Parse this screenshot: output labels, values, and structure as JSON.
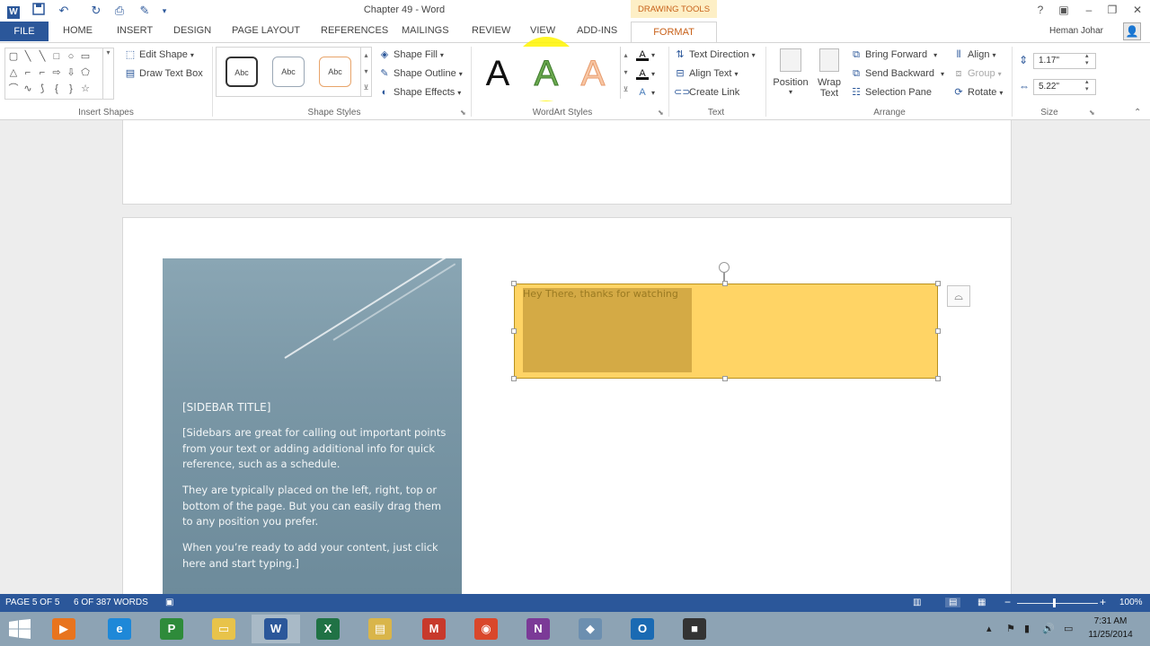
{
  "window": {
    "title": "Chapter 49 - Word",
    "contextual_header": "DRAWING TOOLS",
    "controls": [
      "?",
      "▣",
      "–",
      "❐",
      "✕"
    ]
  },
  "tabs": {
    "file": "FILE",
    "items": [
      "HOME",
      "INSERT",
      "DESIGN",
      "PAGE LAYOUT",
      "REFERENCES",
      "MAILINGS",
      "REVIEW",
      "VIEW",
      "ADD-INS"
    ],
    "active": "FORMAT",
    "user": "Heman Johar"
  },
  "ribbon": {
    "insert_shapes": {
      "label": "Insert Shapes",
      "edit_shape": "Edit Shape",
      "draw_text_box": "Draw Text Box"
    },
    "shape_styles": {
      "label": "Shape Styles",
      "swatch_text": "Abc",
      "swatch_borders": [
        "#333333",
        "#9aa7b5",
        "#e8a46a"
      ],
      "shape_fill": "Shape Fill",
      "shape_outline": "Shape Outline",
      "shape_effects": "Shape Effects"
    },
    "wordart_styles": {
      "label": "WordArt Styles",
      "letter": "A",
      "letter_colors": [
        "#111111",
        "#6aa84f",
        "#f4b183"
      ]
    },
    "text": {
      "label": "Text",
      "text_direction": "Text Direction",
      "align_text": "Align Text",
      "create_link": "Create Link"
    },
    "arrange": {
      "label": "Arrange",
      "position": "Position",
      "wrap_text_1": "Wrap",
      "wrap_text_2": "Text",
      "bring_forward": "Bring Forward",
      "send_backward": "Send Backward",
      "selection_pane": "Selection Pane",
      "align": "Align",
      "group": "Group",
      "rotate": "Rotate"
    },
    "size": {
      "label": "Size",
      "height": "1.17\"",
      "width": "5.22\""
    }
  },
  "document": {
    "sidebar_title": "[SIDEBAR TITLE]",
    "sidebar_p1": "[Sidebars are great for calling out important points from your text or adding additional info for quick reference, such as a schedule.",
    "sidebar_p2": "They are typically placed on the left, right, top or bottom of the page. But you can easily drag them to any position you prefer.",
    "sidebar_p3": "When you’re ready to add your content, just click here and start typing.]",
    "textbox_text": "Hey There, thanks for watching",
    "textbox_fill": "#ffd465"
  },
  "status": {
    "page": "PAGE 5 OF 5",
    "words": "6 OF 387 WORDS",
    "zoom": "100%"
  },
  "taskbar": {
    "apps": [
      {
        "name": "media-player",
        "glyph": "▶",
        "color": "#e8741e"
      },
      {
        "name": "internet-explorer",
        "glyph": "e",
        "color": "#1e88d8"
      },
      {
        "name": "project",
        "glyph": "P",
        "color": "#2e8b3a"
      },
      {
        "name": "folder",
        "glyph": "▭",
        "color": "#e8c34a"
      },
      {
        "name": "word",
        "glyph": "W",
        "color": "#2b579a"
      },
      {
        "name": "excel",
        "glyph": "X",
        "color": "#207245"
      },
      {
        "name": "file-explorer",
        "glyph": "▤",
        "color": "#d9b54a"
      },
      {
        "name": "mail-app",
        "glyph": "M",
        "color": "#c8392b"
      },
      {
        "name": "chrome",
        "glyph": "◉",
        "color": "#d9472b"
      },
      {
        "name": "onenote",
        "glyph": "N",
        "color": "#7b3a97"
      },
      {
        "name": "app-3d",
        "glyph": "◆",
        "color": "#6c8fb0"
      },
      {
        "name": "outlook",
        "glyph": "O",
        "color": "#1a6ab3"
      },
      {
        "name": "camera-app",
        "glyph": "■",
        "color": "#333333"
      }
    ],
    "time": "7:31 AM",
    "date": "11/25/2014"
  }
}
